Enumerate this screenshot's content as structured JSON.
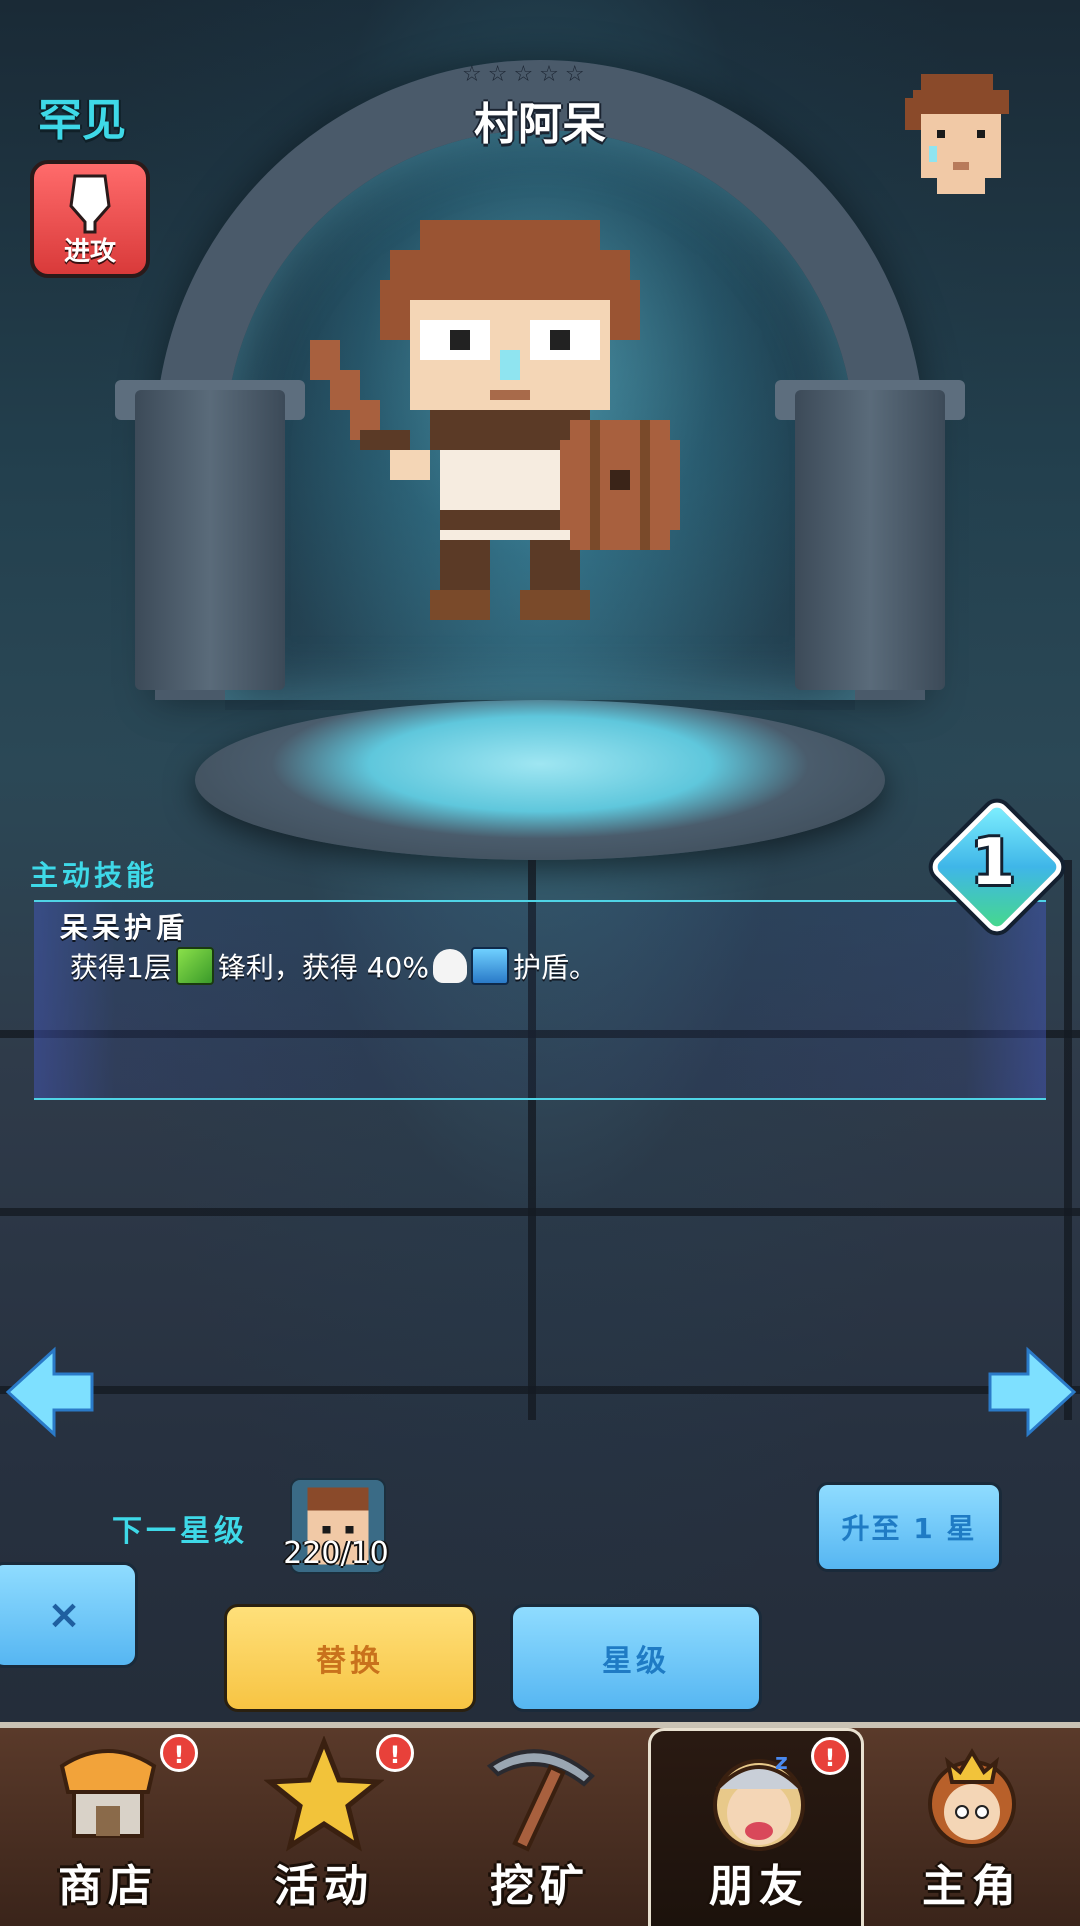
{
  "header": {
    "rarity": "罕见",
    "stars": "☆☆☆☆☆",
    "hero_name": "村阿呆",
    "attack_label": "进攻"
  },
  "skill": {
    "section_title": "主动技能",
    "name": "呆呆护盾",
    "desc_part1": "获得1层",
    "desc_part2": "锋利，获得 40%",
    "desc_part3": "护盾。",
    "level": "1"
  },
  "upgrade": {
    "next_star_label": "下一星级",
    "shard_count": "220/10",
    "upgrade_button": "升至 1 星"
  },
  "actions": {
    "close": "×",
    "replace": "替换",
    "star": "星级"
  },
  "nav": {
    "items": [
      {
        "label": "商店",
        "badge": "!"
      },
      {
        "label": "活动",
        "badge": "!"
      },
      {
        "label": "挖矿",
        "badge": ""
      },
      {
        "label": "朋友",
        "badge": "!"
      },
      {
        "label": "主角",
        "badge": ""
      }
    ]
  },
  "colors": {
    "accent_cyan": "#3ed9e8",
    "attack_red": "#d93a3a",
    "replace_yellow": "#f7c443",
    "button_blue": "#56b6f2"
  }
}
